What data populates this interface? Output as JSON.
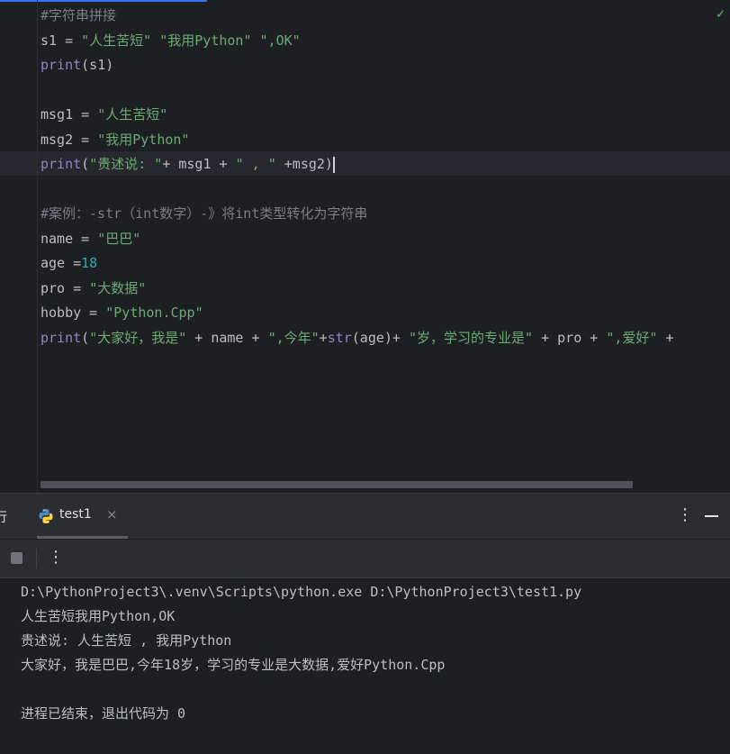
{
  "editor": {
    "lines": [
      [
        {
          "t": "#字符串拼接",
          "c": "comment"
        }
      ],
      [
        {
          "t": "s1 = ",
          "c": "plain"
        },
        {
          "t": "\"人生苦短\" \"我用Python\" \",OK\"",
          "c": "str"
        }
      ],
      [
        {
          "t": "print",
          "c": "fn"
        },
        {
          "t": "(s1)",
          "c": "plain"
        }
      ],
      [],
      [
        {
          "t": "msg1 = ",
          "c": "plain"
        },
        {
          "t": "\"人生苦短\"",
          "c": "str"
        }
      ],
      [
        {
          "t": "msg2 = ",
          "c": "plain"
        },
        {
          "t": "\"我用Python\"",
          "c": "str"
        }
      ],
      [
        {
          "t": "print",
          "c": "fn"
        },
        {
          "t": "(",
          "c": "plain"
        },
        {
          "t": "\"贵述说: \"",
          "c": "str"
        },
        {
          "t": "+ msg1 + ",
          "c": "plain"
        },
        {
          "t": "\" , \"",
          "c": "str"
        },
        {
          "t": " +msg2)",
          "c": "plain"
        }
      ],
      [],
      [
        {
          "t": "#案例：-str（int数字）-》将int类型转化为字符串",
          "c": "comment"
        }
      ],
      [
        {
          "t": "name = ",
          "c": "plain"
        },
        {
          "t": "\"巴巴\"",
          "c": "str"
        }
      ],
      [
        {
          "t": "age =",
          "c": "plain"
        },
        {
          "t": "18",
          "c": "num"
        }
      ],
      [
        {
          "t": "pro = ",
          "c": "plain"
        },
        {
          "t": "\"大数据\"",
          "c": "str"
        }
      ],
      [
        {
          "t": "hobby = ",
          "c": "plain"
        },
        {
          "t": "\"Python.Cpp\"",
          "c": "str"
        }
      ],
      [
        {
          "t": "print",
          "c": "fn"
        },
        {
          "t": "(",
          "c": "plain"
        },
        {
          "t": "\"大家好，我是\"",
          "c": "str"
        },
        {
          "t": " + name + ",
          "c": "plain"
        },
        {
          "t": "\",今年\"",
          "c": "str"
        },
        {
          "t": "+",
          "c": "plain"
        },
        {
          "t": "str",
          "c": "fn"
        },
        {
          "t": "(age)+ ",
          "c": "plain"
        },
        {
          "t": "\"岁，学习的专业是\"",
          "c": "str"
        },
        {
          "t": " + pro + ",
          "c": "plain"
        },
        {
          "t": "\",爱好\"",
          "c": "str"
        },
        {
          "t": " +",
          "c": "plain"
        }
      ]
    ]
  },
  "toolwindow": {
    "run_label": "行",
    "tab_title": "test1",
    "close_glyph": "×",
    "more_glyph": "⋮"
  },
  "console": {
    "lines": [
      "D:\\PythonProject3\\.venv\\Scripts\\python.exe D:\\PythonProject3\\test1.py",
      "人生苦短我用Python,OK",
      "贵述说: 人生苦短 , 我用Python",
      "大家好，我是巴巴,今年18岁，学习的专业是大数据,爱好Python.Cpp",
      "",
      "进程已结束，退出代码为 0"
    ]
  },
  "colors": {
    "background": "#1e1f22",
    "string": "#6aab73",
    "comment": "#7a7e85",
    "builtin": "#8888c6",
    "number": "#2aacb8"
  }
}
